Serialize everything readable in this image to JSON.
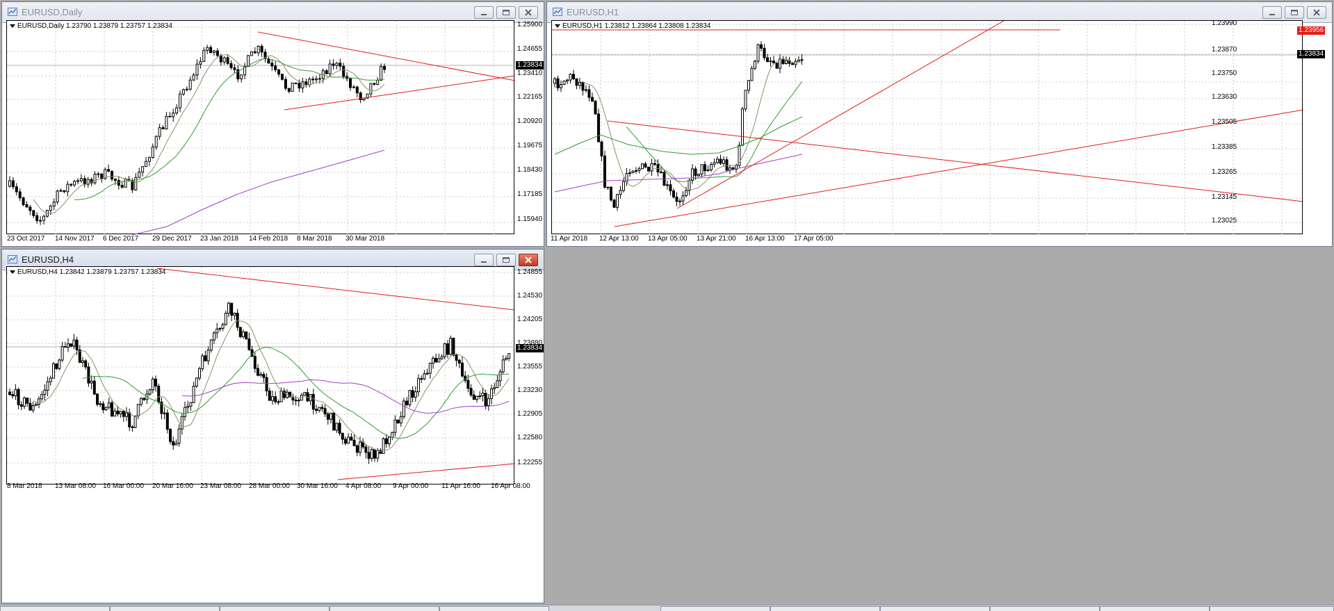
{
  "windows": {
    "daily": {
      "title": "EURUSD,Daily",
      "info": "EURUSD,Daily  1.23790 1.23879 1.23757 1.23834",
      "price_tag": "1.23834",
      "y_ticks": [
        "1.25900",
        "1.24655",
        "1.23410",
        "1.22165",
        "1.20920",
        "1.19675",
        "1.18430",
        "1.17185",
        "1.15940"
      ],
      "x_ticks": [
        "23 Oct 2017",
        "14 Nov 2017",
        "6 Dec 2017",
        "29 Dec 2017",
        "23 Jan 2018",
        "14 Feb 2018",
        "8 Mar 2018",
        "30 Mar 2018"
      ]
    },
    "h1": {
      "title": "EURUSD,H1",
      "info": "EURUSD,H1  1.23812 1.23864 1.23808 1.23834",
      "price_tag": "1.23834",
      "red_tag": "1.23956",
      "y_ticks": [
        "1.23990",
        "1.23870",
        "1.23750",
        "1.23630",
        "1.23505",
        "1.23385",
        "1.23265",
        "1.23145",
        "1.23025"
      ],
      "x_ticks": [
        "11 Apr 2018",
        "12 Apr 13:00",
        "13 Apr 05:00",
        "13 Apr 21:00",
        "16 Apr 13:00",
        "17 Apr 05:00"
      ]
    },
    "h4": {
      "title": "EURUSD,H4",
      "info": "EURUSD,H4  1.23842 1.23879 1.23757 1.23834",
      "price_tag": "1.23834",
      "y_ticks": [
        "1.24855",
        "1.24530",
        "1.24205",
        "1.23880",
        "1.23555",
        "1.23230",
        "1.22905",
        "1.22580",
        "1.22255"
      ],
      "x_ticks": [
        "8 Mar 2018",
        "13 Mar 08:00",
        "16 Mar 00:00",
        "20 Mar 16:00",
        "23 Mar 08:00",
        "28 Mar 00:00",
        "30 Mar 16:00",
        "4 Apr 08:00",
        "9 Apr 00:00",
        "11 Apr 16:00",
        "16 Apr 08:00"
      ]
    }
  },
  "colors": {
    "bull_candle": "#ffffff",
    "bear_candle": "#000000",
    "trendline": "#e31b1b",
    "ma_fast": "#8f8f6a",
    "ma_mid": "#2e9e2e",
    "ma_slow": "#a23ec6"
  },
  "icons": {
    "app": "chart-window-icon",
    "minimize": "minimize-icon",
    "maximize": "maximize-icon",
    "close": "close-icon"
  }
}
